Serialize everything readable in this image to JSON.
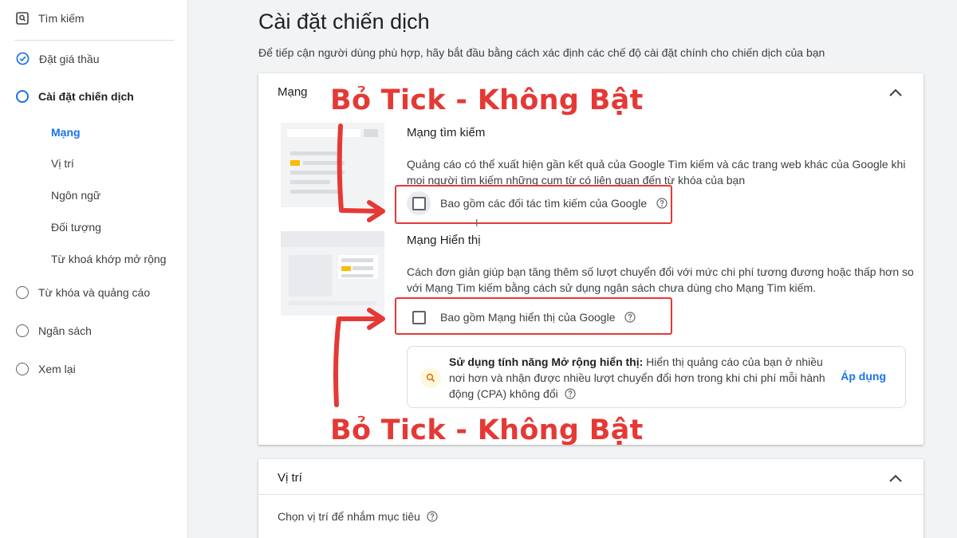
{
  "sidebar": {
    "search_label": "Tìm kiếm",
    "steps": [
      {
        "label": "Đặt giá thầu",
        "state": "done"
      },
      {
        "label": "Cài đặt chiến dịch",
        "state": "active"
      },
      {
        "label": "Từ khóa và quảng cáo",
        "state": "todo"
      },
      {
        "label": "Ngân sách",
        "state": "todo"
      },
      {
        "label": "Xem lại",
        "state": "todo"
      }
    ],
    "subitems": [
      "Mạng",
      "Vị trí",
      "Ngôn ngữ",
      "Đối tượng",
      "Từ khoá khớp mở rộng"
    ]
  },
  "main": {
    "title": "Cài đặt chiến dịch",
    "subtitle": "Để tiếp cận người dùng phù hợp, hãy bắt đầu bằng cách xác định các chế độ cài đặt chính cho chiến dịch của bạn"
  },
  "network_card": {
    "heading": "Mạng",
    "search_network": {
      "title": "Mạng tìm kiếm",
      "description": "Quảng cáo có thể xuất hiện gần kết quả của Google Tìm kiếm và các trang web khác của Google khi mọi người tìm kiếm những cụm từ có liên quan đến từ khóa của bạn",
      "checkbox_label": "Bao gồm các đối tác tìm kiếm của Google",
      "checked": false
    },
    "display_network": {
      "title": "Mạng Hiển thị",
      "description": "Cách đơn giản giúp bạn tăng thêm số lượt chuyển đổi với mức chi phí tương đương hoặc thấp hơn so với Mạng Tìm kiếm bằng cách sử dụng ngân sách chưa dùng cho Mạng Tìm kiếm.",
      "checkbox_label": "Bao gồm Mạng hiển thị của Google",
      "checked": false
    },
    "promo": {
      "bold_text": "Sử dụng tính năng Mở rộng hiển thị:",
      "text": " Hiển thị quảng cáo của bạn ở nhiều nơi hơn và nhận được nhiều lượt chuyển đổi hơn trong khi chi phí mỗi hành động (CPA) không đổi",
      "apply_label": "Áp dụng"
    }
  },
  "location_card": {
    "heading": "Vị trí",
    "prompt": "Chọn vị trí để nhắm mục tiêu"
  },
  "annotations": {
    "top": "Bỏ Tick - Không Bật",
    "bottom": "Bỏ Tick - Không Bật",
    "color": "#e53935"
  },
  "colors": {
    "accent": "#1a73e8",
    "highlight": "#fbbc04"
  }
}
